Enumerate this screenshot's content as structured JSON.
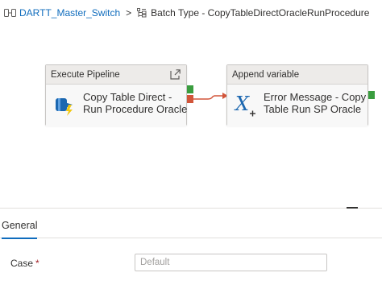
{
  "breadcrumb": {
    "parent": "DARTT_Master_Switch",
    "separator": ">",
    "current": "Batch Type - CopyTableDirectOracleRunProcedure"
  },
  "activities": [
    {
      "type_label": "Execute Pipeline",
      "name_line1": "Copy Table Direct -",
      "name_line2": "Run Procedure Oracle",
      "icon": "execute-pipeline-icon"
    },
    {
      "type_label": "Append variable",
      "name_line1": "Error Message - Copy",
      "name_line2": "Table Run SP Oracle",
      "icon": "append-variable-icon"
    }
  ],
  "tabs": [
    {
      "label": "General",
      "active": true
    }
  ],
  "form": {
    "case_label": "Case",
    "required_mark": "*",
    "case_placeholder": "Default"
  },
  "colors": {
    "link": "#0f6cbd",
    "success_port": "#3a9d3f",
    "failure_port": "#d2553a",
    "connector": "#d2553a",
    "expression_icon": "#0f6cbd"
  }
}
